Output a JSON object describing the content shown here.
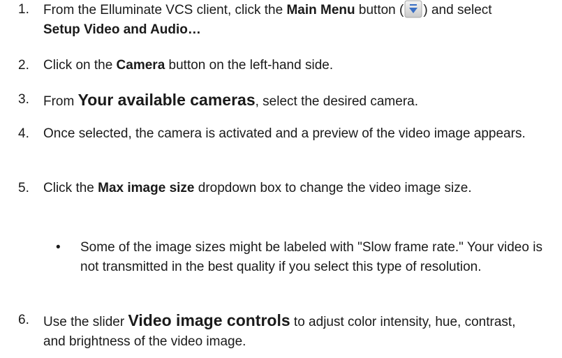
{
  "steps": [
    {
      "number": "1.",
      "parts": {
        "a": "From the Elluminate VCS client, click the ",
        "b": "Main Menu",
        "c": " button (",
        "d": ") and select ",
        "e": "Setup Video and Audio…"
      },
      "icon": "main-menu-icon"
    },
    {
      "number": "2.",
      "parts": {
        "a": "Click on the ",
        "b": "Camera",
        "c": " button on the left-hand side."
      }
    },
    {
      "number": "3.",
      "parts": {
        "a": "From ",
        "b": "Your available cameras",
        "c": ", select the desired camera."
      }
    },
    {
      "number": "4.",
      "parts": {
        "a": "Once selected, the camera is activated and a preview of the video image appears."
      }
    },
    {
      "number": "5.",
      "parts": {
        "a": "Click the ",
        "b": "Max image size",
        "c": " dropdown box to change the video image size."
      },
      "bullets": [
        {
          "symbol": "•",
          "text": "Some of the image sizes might be labeled with \"Slow frame rate.\" Your video is not transmitted in the best quality if you select this type of resolution."
        }
      ]
    },
    {
      "number": "6.",
      "parts": {
        "a": "Use the slider ",
        "b": "Video image controls",
        "c": " to adjust color intensity, hue, contrast, and brightness of the video image."
      }
    }
  ],
  "colors": {
    "text": "#1a1a1a",
    "icon_bg_top": "#f4f4f4",
    "icon_bg_bottom": "#c9c9c9",
    "icon_glyph": "#3a6fc4"
  }
}
